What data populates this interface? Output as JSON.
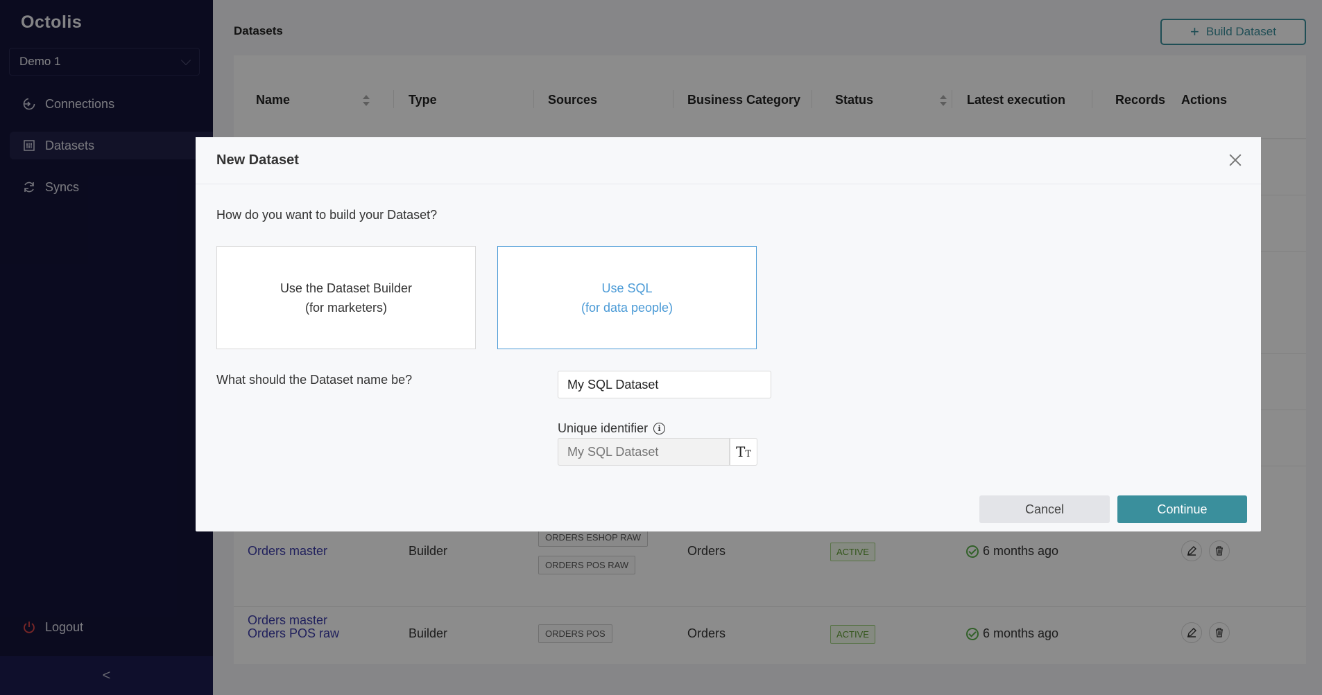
{
  "sidebar": {
    "logo": "Octolis",
    "workspace": "Demo 1",
    "items": [
      {
        "label": "Connections",
        "icon": "connections-icon"
      },
      {
        "label": "Datasets",
        "icon": "datasets-icon"
      },
      {
        "label": "Syncs",
        "icon": "syncs-icon"
      }
    ],
    "logout": "Logout",
    "collapse": "<"
  },
  "main": {
    "title": "Datasets",
    "build_button": "Build Dataset",
    "columns": [
      "Name",
      "Type",
      "Sources",
      "Business Category",
      "Status",
      "Latest execution",
      "Records",
      "Actions"
    ],
    "rows": [
      {
        "name": "Orders master",
        "type": "Builder",
        "sources": [
          "ORDERS ESHOP RAW",
          "ORDERS POS RAW"
        ],
        "category": "Orders",
        "status": "ACTIVE",
        "latest": "6 months ago"
      },
      {
        "name": "Orders POS raw",
        "type": "Builder",
        "sources": [
          "ORDERS POS"
        ],
        "category": "Orders",
        "status": "ACTIVE",
        "latest": "6 months ago"
      }
    ]
  },
  "modal": {
    "title": "New Dataset",
    "question": "How do you want to build your Dataset?",
    "option_builder": {
      "line1": "Use the Dataset Builder",
      "line2": "(for marketers)"
    },
    "option_sql": {
      "line1": "Use SQL",
      "line2": "(for data people)"
    },
    "name_question": "What should the Dataset name be?",
    "name_value": "My SQL Dataset",
    "uid_label": "Unique identifier",
    "uid_placeholder": "My SQL Dataset",
    "cancel": "Cancel",
    "continue": "Continue"
  },
  "colors": {
    "sidebar_bg": "#14143a",
    "accent": "#3a8f9c",
    "selected_option": "#4a9ad6",
    "link": "#3b3ba8",
    "active_badge": "#5c9b2f"
  }
}
